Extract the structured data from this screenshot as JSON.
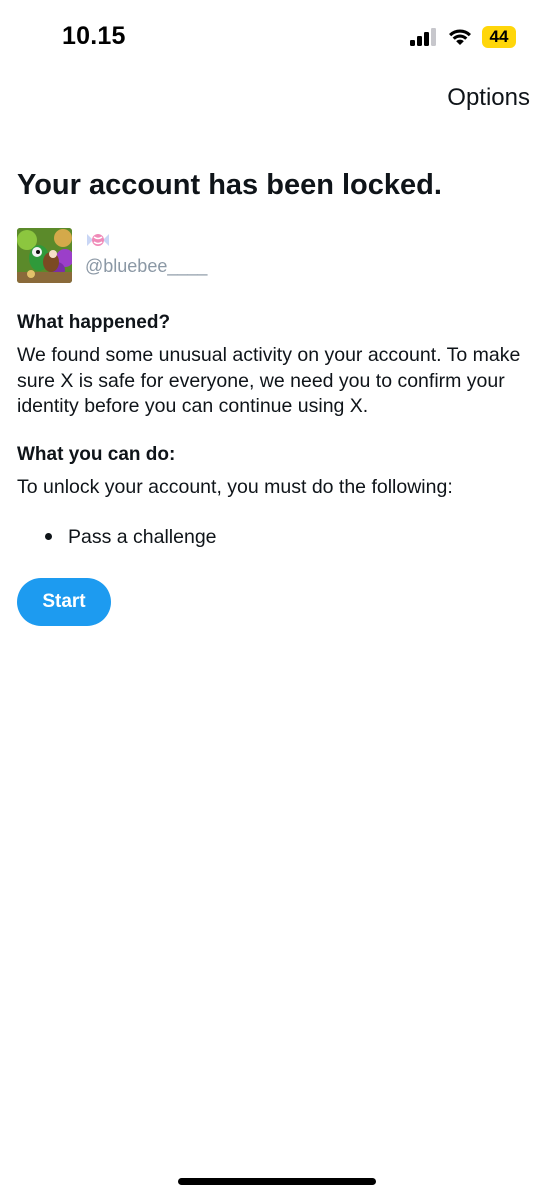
{
  "status_bar": {
    "time": "10.15",
    "battery": "44",
    "battery_color": "#ffd60a",
    "icons": [
      "signal-icon",
      "wifi-icon"
    ]
  },
  "nav": {
    "options_label": "Options"
  },
  "page": {
    "title": "Your account has been locked."
  },
  "user": {
    "display_name_icon": "candy-icon",
    "username": "@bluebee____"
  },
  "what_happened": {
    "heading": "What happened?",
    "line1": "We found some unusual activity on your account. To make",
    "line2": "sure X is safe for everyone, we need you to confirm your",
    "line3": "identity before you can continue using X."
  },
  "what_you_can_do": {
    "heading": "What you can do:",
    "intro": "To unlock your account, you must do the following:",
    "items": [
      "Pass a challenge"
    ]
  },
  "actions": {
    "start_label": "Start",
    "accent_color": "#1d9bf0"
  }
}
